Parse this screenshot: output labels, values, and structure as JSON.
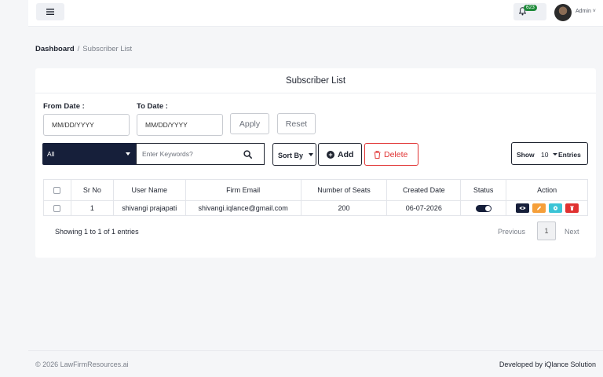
{
  "topbar": {
    "notification_count": "623",
    "user_label": "Admin ˅"
  },
  "breadcrumb": {
    "home": "Dashboard",
    "separator": "/",
    "current": "Subscriber List"
  },
  "card": {
    "title": "Subscriber List"
  },
  "filters": {
    "from_label": "From Date :",
    "from_placeholder": "MM/DD/YYYY",
    "to_label": "To Date :",
    "to_placeholder": "MM/DD/YYYY",
    "apply_label": "Apply",
    "reset_label": "Reset"
  },
  "toolbar": {
    "category_selected": "All",
    "search_placeholder": "Enter Keywords?",
    "sort_label": "Sort By",
    "add_label": "Add",
    "delete_label": "Delete",
    "show_label": "Show",
    "show_value": "10",
    "entries_label": "Entries"
  },
  "table": {
    "columns": [
      "Sr No",
      "User Name",
      "Firm Email",
      "Number of Seats",
      "Created Date",
      "Status",
      "Action"
    ],
    "rows": [
      {
        "sr_no": "1",
        "user_name": "shivangi prajapati",
        "firm_email": "shivangi.iqlance@gmail.com",
        "seats": "200",
        "created_date": "06-07-2026",
        "status_active": true
      }
    ]
  },
  "pagination": {
    "summary": "Showing 1 to 1 of 1 entries",
    "previous": "Previous",
    "current_page": "1",
    "next": "Next"
  },
  "footer": {
    "copyright": "© 2026 LawFirmResources.ai",
    "developer": "Developed by iQlance Solution"
  },
  "colors": {
    "primary_dark": "#161f3a",
    "danger": "#e03131",
    "warning": "#f59f3a",
    "info": "#3bc4d6",
    "success_badge": "#1e8a3a"
  },
  "icons": {
    "menu": "hamburger-icon",
    "bell": "bell-icon",
    "search": "search-icon",
    "add": "plus-circle-icon",
    "delete": "trash-icon",
    "view": "eye-icon",
    "edit": "pencil-icon",
    "settings": "gear-icon",
    "remove": "trash-icon"
  }
}
